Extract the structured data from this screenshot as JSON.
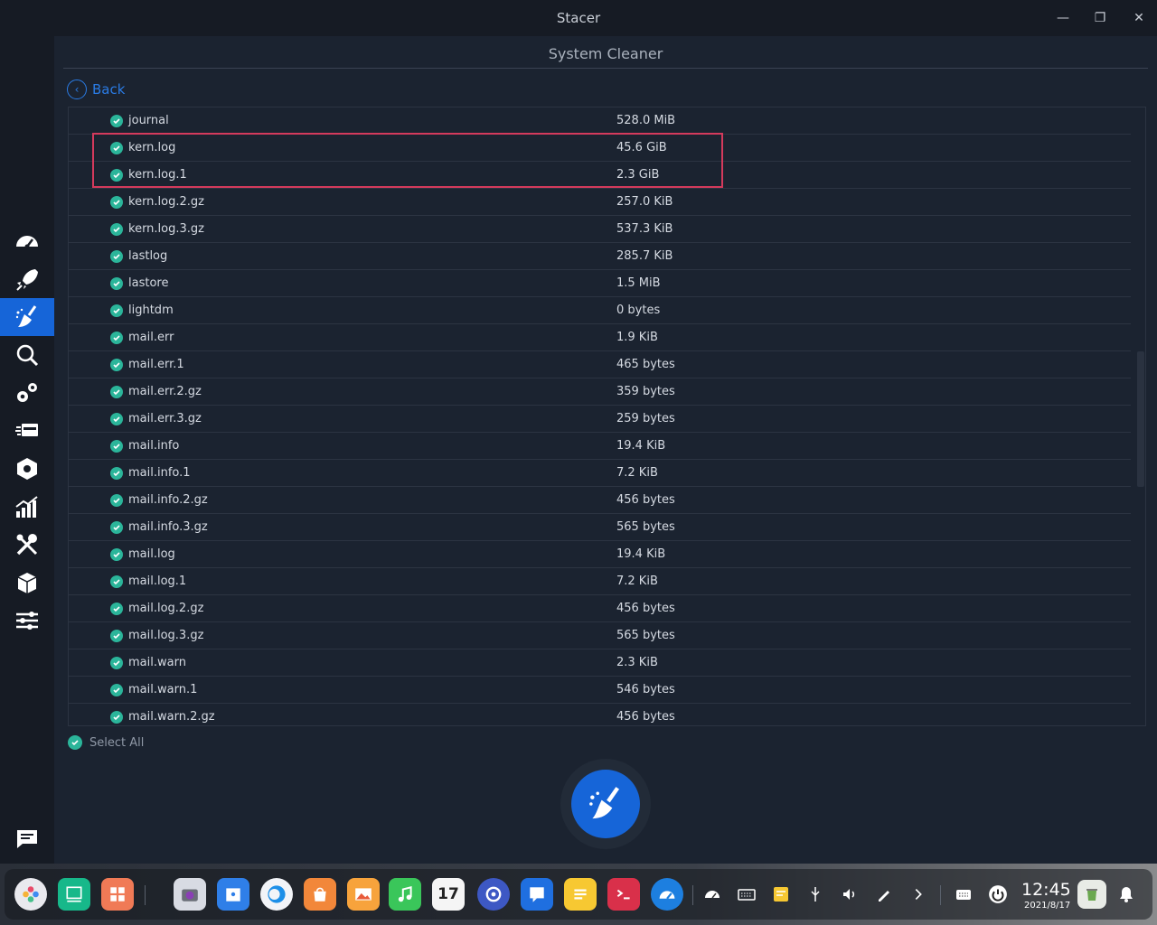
{
  "window": {
    "title": "Stacer",
    "minimize_glyph": "—",
    "maximize_glyph": "❐",
    "close_glyph": "✕"
  },
  "sidebar": {
    "items": [
      {
        "name": "dashboard-icon",
        "active": false
      },
      {
        "name": "startup-apps-icon",
        "active": false
      },
      {
        "name": "system-cleaner-icon",
        "active": true
      },
      {
        "name": "search-icon",
        "active": false
      },
      {
        "name": "services-icon",
        "active": false
      },
      {
        "name": "processes-icon",
        "active": false
      },
      {
        "name": "uninstaller-icon",
        "active": false
      },
      {
        "name": "resources-icon",
        "active": false
      },
      {
        "name": "helpers-icon",
        "active": false
      },
      {
        "name": "apt-repository-icon",
        "active": false
      },
      {
        "name": "settings-icon",
        "active": false
      }
    ],
    "feedback_icon": "feedback-icon"
  },
  "page": {
    "title": "System Cleaner",
    "back_label": "Back",
    "select_all_label": "Select All"
  },
  "files": [
    {
      "name": "journal",
      "size": "528.0 MiB"
    },
    {
      "name": "kern.log",
      "size": "45.6 GiB"
    },
    {
      "name": "kern.log.1",
      "size": "2.3 GiB"
    },
    {
      "name": "kern.log.2.gz",
      "size": "257.0 KiB"
    },
    {
      "name": "kern.log.3.gz",
      "size": "537.3 KiB"
    },
    {
      "name": "lastlog",
      "size": "285.7 KiB"
    },
    {
      "name": "lastore",
      "size": "1.5 MiB"
    },
    {
      "name": "lightdm",
      "size": "0 bytes"
    },
    {
      "name": "mail.err",
      "size": "1.9 KiB"
    },
    {
      "name": "mail.err.1",
      "size": "465 bytes"
    },
    {
      "name": "mail.err.2.gz",
      "size": "359 bytes"
    },
    {
      "name": "mail.err.3.gz",
      "size": "259 bytes"
    },
    {
      "name": "mail.info",
      "size": "19.4 KiB"
    },
    {
      "name": "mail.info.1",
      "size": "7.2 KiB"
    },
    {
      "name": "mail.info.2.gz",
      "size": "456 bytes"
    },
    {
      "name": "mail.info.3.gz",
      "size": "565 bytes"
    },
    {
      "name": "mail.log",
      "size": "19.4 KiB"
    },
    {
      "name": "mail.log.1",
      "size": "7.2 KiB"
    },
    {
      "name": "mail.log.2.gz",
      "size": "456 bytes"
    },
    {
      "name": "mail.log.3.gz",
      "size": "565 bytes"
    },
    {
      "name": "mail.warn",
      "size": "2.3 KiB"
    },
    {
      "name": "mail.warn.1",
      "size": "546 bytes"
    },
    {
      "name": "mail.warn.2.gz",
      "size": "456 bytes"
    }
  ],
  "colors": {
    "accent": "#1665d8",
    "check": "#2bb59a",
    "highlight": "#d43a5c"
  },
  "taskbar": {
    "clock_time": "12:45",
    "clock_date": "2021/8/17",
    "calendar_day": "17"
  }
}
